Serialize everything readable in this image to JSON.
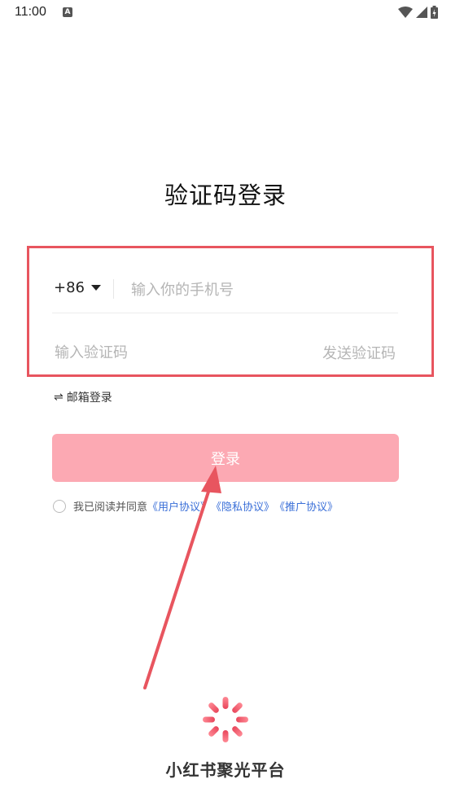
{
  "status_bar": {
    "time": "11:00",
    "notification_icon": "A"
  },
  "title": "验证码登录",
  "form": {
    "country_code": "+86",
    "phone_placeholder": "输入你的手机号",
    "code_placeholder": "输入验证码",
    "send_code_label": "发送验证码"
  },
  "email_login": {
    "icon": "⇌",
    "label": "邮箱登录"
  },
  "login_button_label": "登录",
  "agreement": {
    "prefix": "我已阅读并同意",
    "links": [
      "《用户协议》",
      "《隐私协议》",
      "《推广协议》"
    ]
  },
  "brand": {
    "name": "小红书聚光平台"
  },
  "colors": {
    "accent_red": "#e8555f",
    "button_pink": "#fca9b3",
    "link_blue": "#3a6fd8"
  }
}
